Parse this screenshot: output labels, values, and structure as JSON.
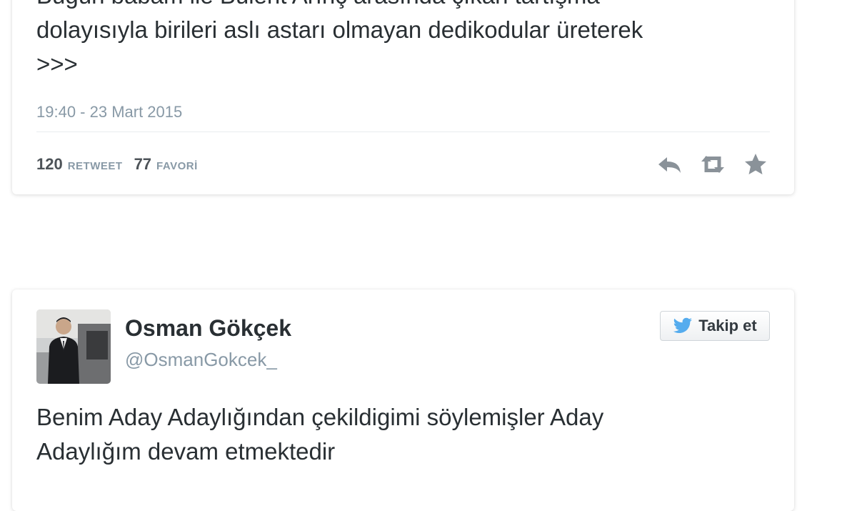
{
  "tweet1": {
    "text_lines": [
      "Bugün babam ile Bülent Arınç arasında çıkan tartışma",
      "dolayısıyla birileri aslı astarı olmayan dedikodular üreterek",
      ">>>"
    ],
    "timestamp": "19:40 - 23 Mart 2015",
    "retweet_count": "120",
    "retweet_label": "RETWEET",
    "favorite_count": "77",
    "favorite_label": "FAVORİ",
    "actions": [
      "reply-icon",
      "retweet-icon",
      "favorite-star-icon"
    ]
  },
  "tweet2": {
    "user_name": "Osman Gökçek",
    "user_handle": "@OsmanGokcek_",
    "follow_label": "Takip et",
    "follow_icon": "twitter-bird-icon",
    "text_lines": [
      "Benim Aday Adaylığından çekildigimi söylemişler Aday",
      "Adaylığım devam etmektedir"
    ]
  },
  "colors": {
    "twitter_blue": "#55acee",
    "muted_text": "#8899a6",
    "body_text": "#292f33",
    "icon_gray": "#8a9299"
  }
}
